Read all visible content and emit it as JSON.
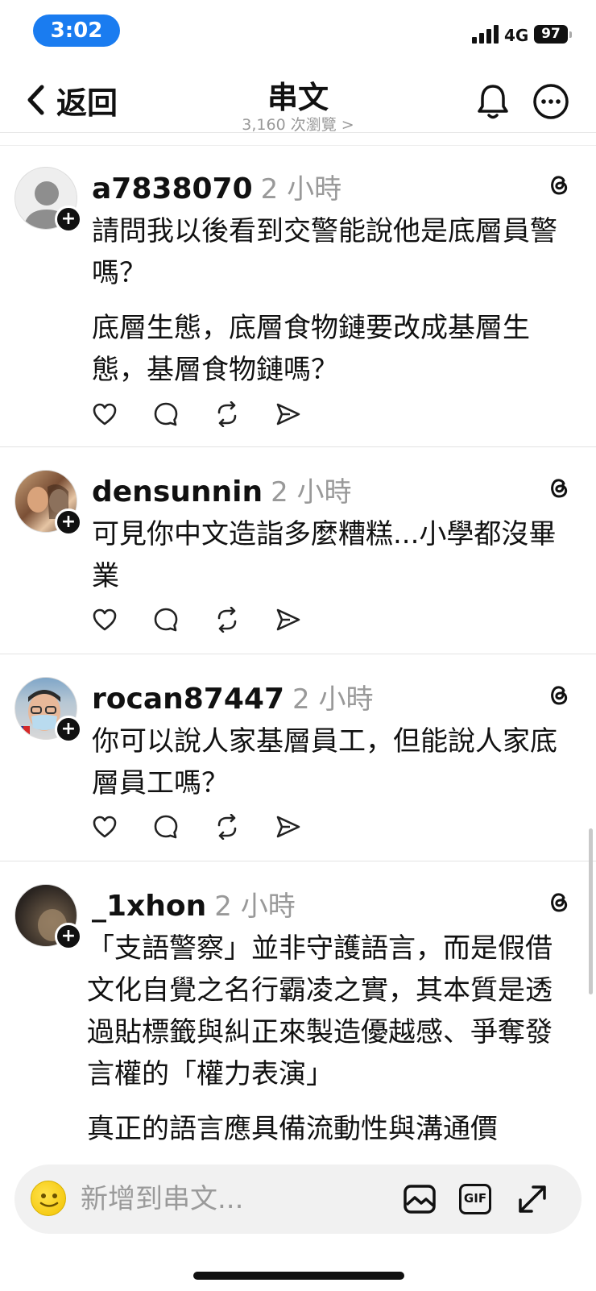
{
  "status_bar": {
    "time": "3:02",
    "network": "4G",
    "battery": "97"
  },
  "header": {
    "back_label": "返回",
    "title": "串文",
    "views": "3,160 次瀏覽 >"
  },
  "posts": [
    {
      "username": "a7838070",
      "time": "2 小時",
      "paragraphs": [
        "請問我以後看到交警能說他是底層員警嗎？",
        "底層生態，底層食物鏈要改成基層生態，基層食物鏈嗎？"
      ]
    },
    {
      "username": "densunnin",
      "time": "2 小時",
      "paragraphs": [
        "可見你中文造詣多麼糟糕...小學都沒畢業"
      ]
    },
    {
      "username": "rocan87447",
      "time": "2 小時",
      "paragraphs": [
        "你可以說人家基層員工，但能說人家底層員工嗎？"
      ]
    },
    {
      "username": "_1xhon",
      "time": "2 小時",
      "paragraphs": [
        "「支語警察」並非守護語言，而是假借文化自覺之名行霸凌之實，其本質是透過貼標籤與糾正來製造優越感、爭奪發言權的「權力表演」",
        "真正的語言應具備流動性與溝通價"
      ]
    }
  ],
  "composer": {
    "placeholder": "新增到串文...",
    "gif_label": "GIF"
  }
}
